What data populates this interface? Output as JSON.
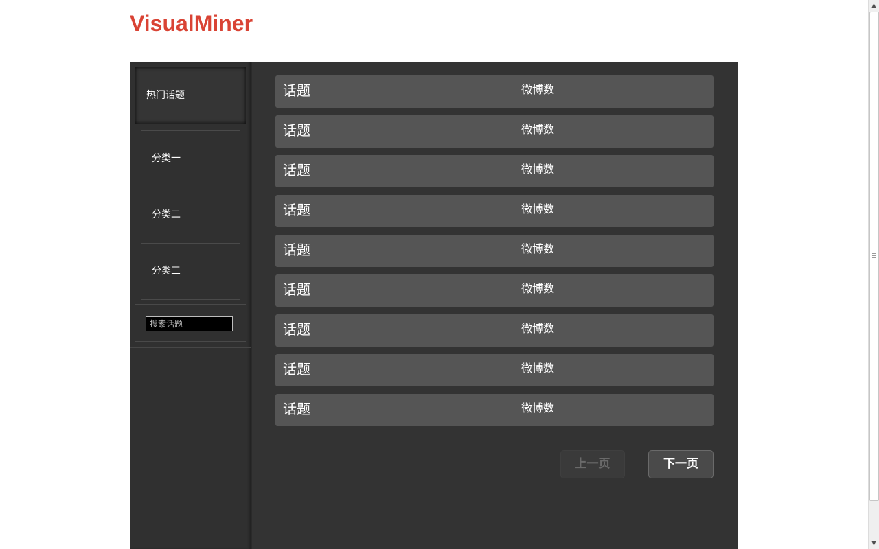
{
  "app": {
    "logo": "VisualMiner",
    "brand_color": "#d94334"
  },
  "sidebar": {
    "active_item": "热门话题",
    "items": [
      "分类一",
      "分类二",
      "分类三"
    ],
    "search": {
      "placeholder": "搜索话题",
      "value": ""
    }
  },
  "topics": {
    "rows": [
      {
        "topic": "话题",
        "count": "微博数"
      },
      {
        "topic": "话题",
        "count": "微博数"
      },
      {
        "topic": "话题",
        "count": "微博数"
      },
      {
        "topic": "话题",
        "count": "微博数"
      },
      {
        "topic": "话题",
        "count": "微博数"
      },
      {
        "topic": "话题",
        "count": "微博数"
      },
      {
        "topic": "话题",
        "count": "微博数"
      },
      {
        "topic": "话题",
        "count": "微博数"
      },
      {
        "topic": "话题",
        "count": "微博数"
      }
    ]
  },
  "pagination": {
    "prev_label": "上一页",
    "next_label": "下一页",
    "prev_enabled": false
  },
  "colors": {
    "panel_bg": "#333333",
    "row_bg": "#555555"
  }
}
